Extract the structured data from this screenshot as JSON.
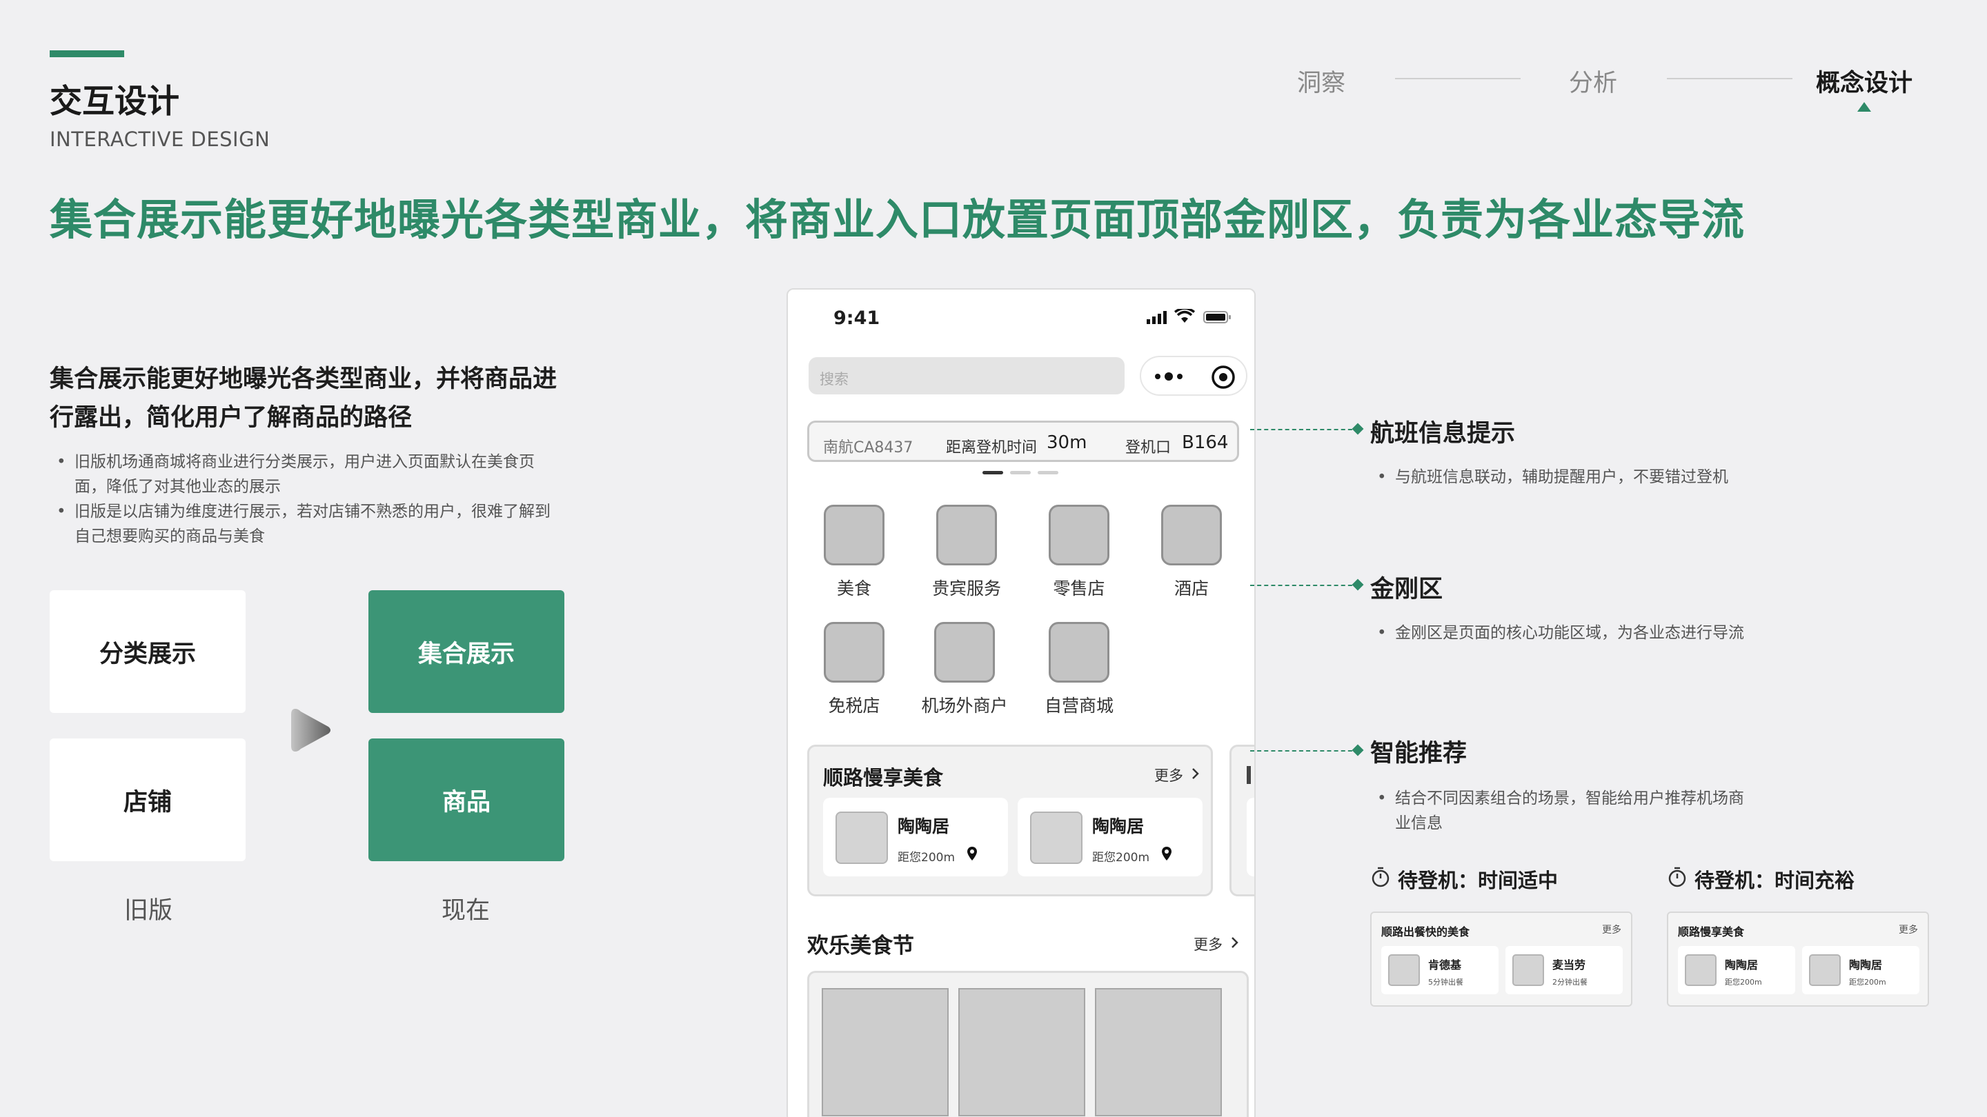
{
  "header": {
    "title": "交互设计",
    "subtitle": "INTERACTIVE DESIGN",
    "headline": "集合展示能更好地曝光各类型商业，将商业入口放置页面顶部金刚区，负责为各业态导流",
    "steps": [
      "洞察",
      "分析",
      "概念设计"
    ],
    "active_step": "概念设计",
    "accent_color": "#2e8a68"
  },
  "left": {
    "heading": "集合展示能更好地曝光各类型商业，并将商品进行露出，简化用户了解商品的路径",
    "bullets": [
      "旧版机场通商城将商业进行分类展示，用户进入页面默认在美食页面，降低了对其他业态的展示",
      "旧版是以店铺为维度进行展示，若对店铺不熟悉的用户，很难了解到自己想要购买的商品与美食"
    ],
    "old_cards": [
      "分类展示",
      "店铺"
    ],
    "new_cards": [
      "集合展示",
      "商品"
    ],
    "old_caption": "旧版",
    "new_caption": "现在",
    "new_card_color": "#3c9576"
  },
  "phone": {
    "time": "9:41",
    "search_placeholder": "搜索",
    "flight": {
      "number": "南航CA8437",
      "boarding_label": "距离登机时间",
      "boarding_value": "30m",
      "gate_label": "登机口",
      "gate_value": "B164"
    },
    "categories": [
      "美食",
      "贵宾服务",
      "零售店",
      "酒店",
      "免税店",
      "机场外商户",
      "自营商城"
    ],
    "recommend": {
      "title": "顺路慢享美食",
      "more": "更多",
      "items": [
        {
          "name": "陶陶居",
          "distance": "距您200m"
        },
        {
          "name": "陶陶居",
          "distance": "距您200m"
        }
      ]
    },
    "festival": {
      "title": "欢乐美食节",
      "more": "更多"
    }
  },
  "annotations": {
    "flight": {
      "title": "航班信息提示",
      "desc": "与航班信息联动，辅助提醒用户，不要错过登机"
    },
    "kingkong": {
      "title": "金刚区",
      "desc": "金刚区是页面的核心功能区域，为各业态进行导流"
    },
    "smart": {
      "title": "智能推荐",
      "desc_line1": "结合不同因素组合的场景，智能给用户推荐机场商",
      "desc_line2": "业信息"
    },
    "scene_a": {
      "title": "待登机：时间适中",
      "card_title": "顺路出餐快的美食",
      "more": "更多",
      "items": [
        {
          "name": "肯德基",
          "note": "5分钟出餐"
        },
        {
          "name": "麦当劳",
          "note": "2分钟出餐"
        }
      ]
    },
    "scene_b": {
      "title": "待登机：时间充裕",
      "card_title": "顺路慢享美食",
      "more": "更多",
      "items": [
        {
          "name": "陶陶居",
          "note": "距您200m"
        },
        {
          "name": "陶陶居",
          "note": "距您200m"
        }
      ]
    }
  }
}
